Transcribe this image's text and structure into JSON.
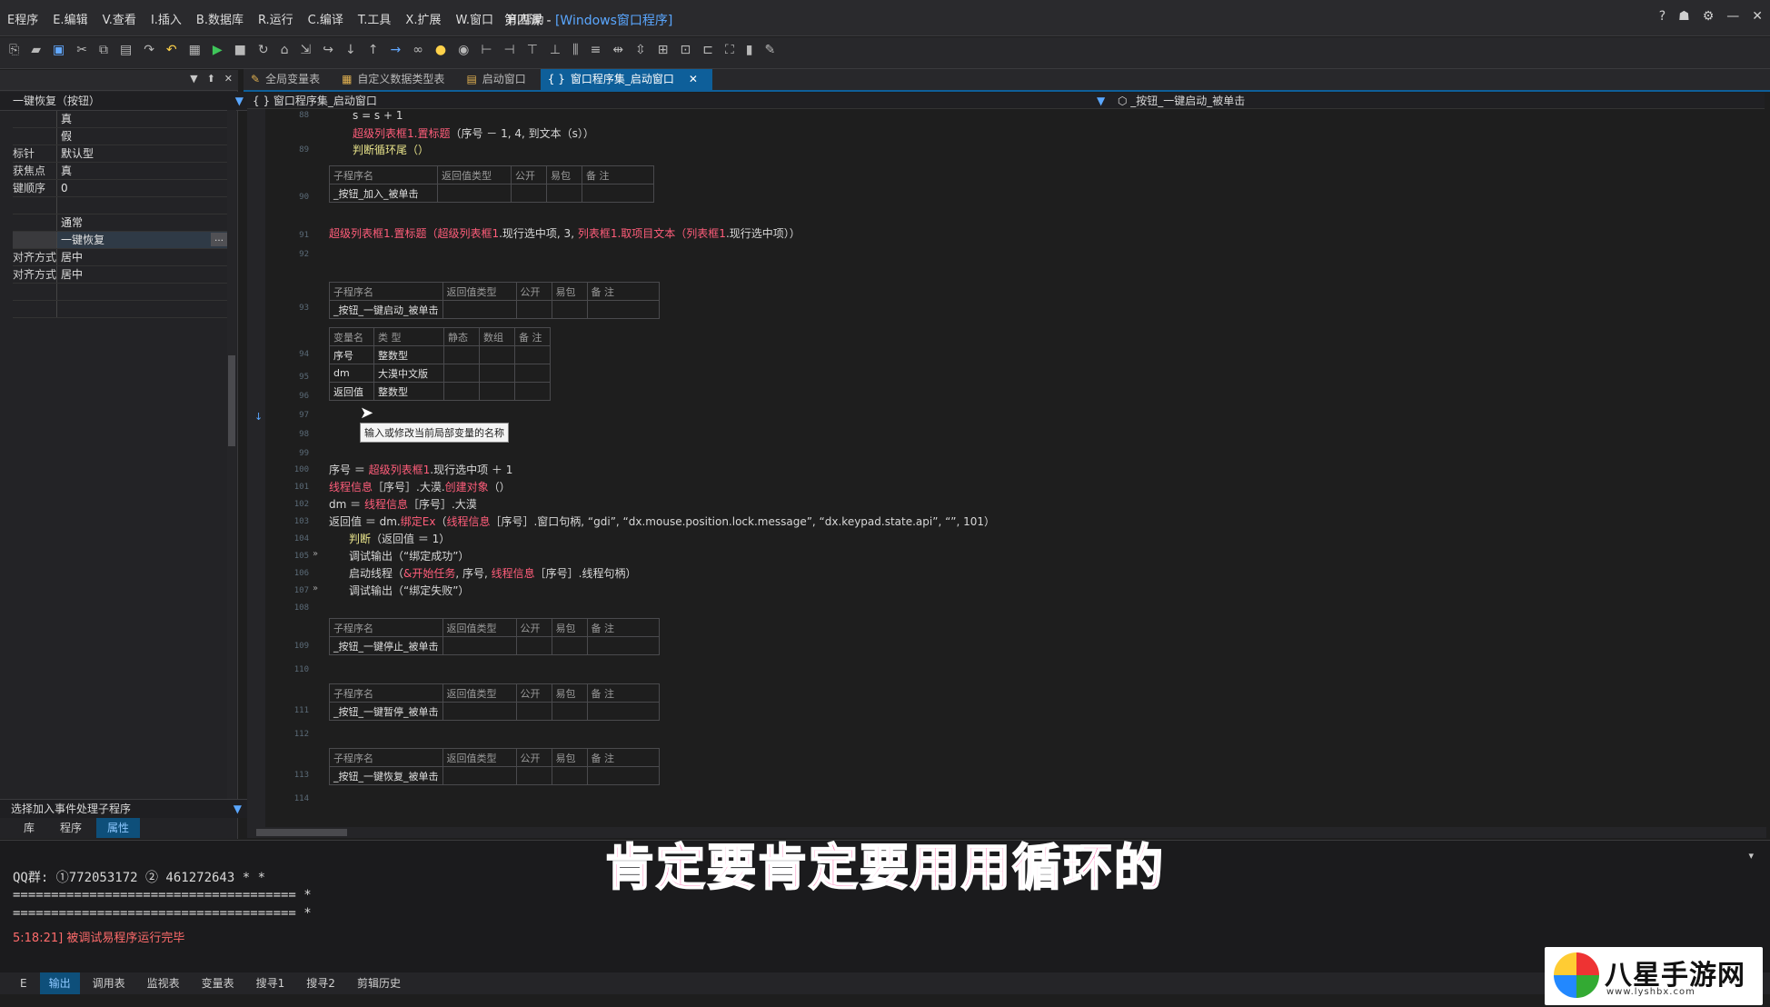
{
  "menubar": {
    "items": [
      "E程序",
      "E.编辑",
      "V.查看",
      "I.插入",
      "B.数据库",
      "R.运行",
      "C.编译",
      "T.工具",
      "X.扩展",
      "W.窗口",
      "H.帮助"
    ],
    "title_prefix": "第四课 - ",
    "title_highlight": "[Windows窗口程序]",
    "win_buttons": [
      "?",
      "☗",
      "⚙",
      "—",
      "✕"
    ]
  },
  "left_panel": {
    "header_controls": [
      "▼",
      "⬆",
      "✕"
    ],
    "selector_label": "一键恢复（按钮）",
    "selector_dd": "▼",
    "properties": [
      {
        "k": "",
        "v": "真"
      },
      {
        "k": "",
        "v": "假"
      },
      {
        "k": "标针",
        "v": "默认型"
      },
      {
        "k": "获焦点",
        "v": "真"
      },
      {
        "k": "键顺序",
        "v": "0"
      },
      {
        "k": "",
        "v": ""
      },
      {
        "k": "",
        "v": "通常"
      },
      {
        "k": "",
        "v": "一键恢复",
        "selected": true,
        "ellipsis": "…"
      },
      {
        "k": "对齐方式",
        "v": "居中"
      },
      {
        "k": "对齐方式",
        "v": "居中"
      },
      {
        "k": "",
        "v": ""
      },
      {
        "k": "",
        "v": ""
      }
    ],
    "event_selector": "选择加入事件处理子程序",
    "event_dd": "▼",
    "tabs": [
      "库",
      "程序",
      "属性"
    ]
  },
  "doc_tabs": [
    {
      "icon": "✎",
      "label": "全局变量表"
    },
    {
      "icon": "▦",
      "label": "自定义数据类型表"
    },
    {
      "icon": "▤",
      "label": "启动窗口"
    },
    {
      "icon": "{ }",
      "label": "窗口程序集_启动窗口",
      "active": true,
      "close": "✕"
    }
  ],
  "code_nav": {
    "left": "{ } 窗口程序集_启动窗口",
    "mid": "▼",
    "right": "⬡  _按钮_一键启动_被单击"
  },
  "code": {
    "line_s": "s = s + 1",
    "line_set_title_obj": "超级列表框1.置标题",
    "line_set_title_args": "（序号 － 1, 4, 到文本（s））",
    "line_loop_end": "判断循环尾（）",
    "tbl_hdr": [
      "子程序名",
      "返回值类型",
      "公开",
      "易包",
      "备 注"
    ],
    "sub_add": "_按钮_加入_被单击",
    "line_setitem_a": "超级列表框1",
    "line_setitem_b": ".置标题（",
    "line_setitem_c": "超级列表框1",
    "line_setitem_d": ".现行选中项, 3, ",
    "line_setitem_e": "列表框1",
    "line_setitem_f": ".取项目文本（",
    "line_setitem_g": "列表框1",
    "line_setitem_h": ".现行选中项））",
    "sub_start": "_按钮_一键启动_被单击",
    "var_hdr": [
      "变量名",
      "类 型",
      "静态",
      "数组",
      "备 注"
    ],
    "vars": [
      {
        "name": "序号",
        "type": "整数型"
      },
      {
        "name": "dm",
        "type": "大漠中文版"
      },
      {
        "name": "返回值",
        "type": "整数型"
      }
    ],
    "tooltip": "输入或修改当前局部变量的名称",
    "l1a": "序号 ＝ ",
    "l1b": "超级列表框1",
    "l1c": ".现行选中项 ＋ 1",
    "l2a": "线程信息",
    "l2b": "［序号］.大漠.",
    "l2c": "创建对象",
    "l2d": "（）",
    "l3a": "dm ＝ ",
    "l3b": "线程信息",
    "l3c": "［序号］.大漠",
    "l4a": "返回值 ＝ dm.",
    "l4b": "绑定Ex",
    "l4c": "（",
    "l4d": "线程信息",
    "l4e": "［序号］.窗口句柄, “gdi”, “dx.mouse.position.lock.message”, “dx.keypad.state.api”, “”, 101）",
    "l5a": "判断",
    "l5b": "（返回值 ＝ 1）",
    "l6": "调试输出（“绑定成功”）",
    "l7a": "启动线程（",
    "l7b": "&开始任务",
    "l7c": ", 序号, ",
    "l7d": "线程信息",
    "l7e": "［序号］.线程句柄）",
    "l8": "调试输出（“绑定失败”）",
    "sub_stop": "_按钮_一键停止_被单击",
    "sub_pause": "_按钮_一键暂停_被单击",
    "sub_restore": "_按钮_一键恢复_被单击",
    "line_numbers": [
      "88",
      "89",
      "90",
      "91",
      "92",
      "93",
      "94",
      "95",
      "96",
      "97",
      "98",
      "99",
      "100",
      "101",
      "102",
      "103",
      "104",
      "105",
      "106",
      "107",
      "108",
      "109",
      "110",
      "111",
      "112",
      "113",
      "114"
    ]
  },
  "output": {
    "qq": "QQ群: ①772053172 ② 461272643 * *",
    "sep1": "===================================== *",
    "sep2": "===================================== *",
    "msg": "5:18:21] 被调试易程序运行完毕",
    "collapse": "▾"
  },
  "bottom_tabs": [
    "E",
    "输出",
    "调用表",
    "监视表",
    "变量表",
    "搜寻1",
    "搜寻2",
    "剪辑历史"
  ],
  "subtitle": "肯定要肯定要用用循环的",
  "watermark": {
    "name": "八星手游网",
    "url": "www.lyshbx.com"
  }
}
